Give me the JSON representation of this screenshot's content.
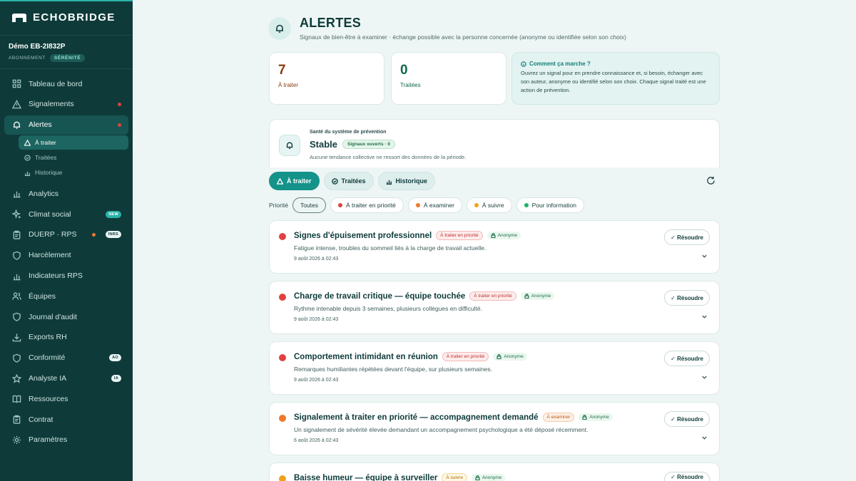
{
  "brand": {
    "name": "ECHOBRIDGE"
  },
  "account": {
    "name": "Démo EB-2I832P",
    "plan_label": "ABONNEMENT",
    "plan": "SÉRÉNITÉ"
  },
  "nav": {
    "dashboard": "Tableau de bord",
    "reports": "Signalements",
    "alerts": "Alertes",
    "alerts_sub": {
      "todo": "À traiter",
      "done": "Traitées",
      "history": "Historique"
    },
    "analytics": "Analytics",
    "climate": "Climat social",
    "climate_tag": "NEW",
    "duerp": "DUERP · RPS",
    "duerp_tag": "INRS",
    "harassment": "Harcèlement",
    "indicators": "Indicateurs RPS",
    "teams": "Équipes",
    "audit": "Journal d'audit",
    "exports": "Exports RH",
    "compliance": "Conformité",
    "compliance_tag": "AO",
    "ai": "Analyste IA",
    "ai_tag": "IA",
    "resources": "Ressources",
    "contract": "Contrat",
    "settings": "Paramètres"
  },
  "header": {
    "title": "ALERTES",
    "subtitle": "Signaux de bien-être à examiner · échange possible avec la personne concernée (anonyme ou identifiée selon son choix)"
  },
  "stats": {
    "todo": {
      "value": "7",
      "label": "À traiter",
      "color": "#8a3b12"
    },
    "done": {
      "value": "0",
      "label": "Traitées",
      "color": "#0e6b4a"
    }
  },
  "how": {
    "title": "Comment ça marche ?",
    "text": "Ouvrez un signal pour en prendre connaissance et, si besoin, échanger avec son auteur, anonyme ou identifié selon son choix. Chaque signal traité est une action de prévention."
  },
  "health": {
    "label": "Santé du système de prévention",
    "status": "Stable",
    "badge": "Signaux ouverts · 0",
    "desc": "Aucune tendance collective ne ressort des données de la période."
  },
  "tabs": {
    "todo": "À traiter",
    "done": "Traitées",
    "history": "Historique"
  },
  "filters": {
    "label": "Priorité",
    "all": "Toutes",
    "priority": "À traiter en priorité",
    "examine": "À examiner",
    "follow": "À suivre",
    "info": "Pour information"
  },
  "colors": {
    "red": "#e0413f",
    "orange": "#ee7a2b",
    "amber": "#f0a21f",
    "green": "#20b36b"
  },
  "alerts": [
    {
      "title": "Signes d'épuisement professionnel",
      "badge": "À traiter en priorité",
      "anon": "Anonyme",
      "desc": "Fatigue intense, troubles du sommeil liés à la charge de travail actuelle.",
      "date": "9 août 2026 à 02:43",
      "resolve": "✓ Résoudre"
    },
    {
      "title": "Charge de travail critique — équipe touchée",
      "badge": "À traiter en priorité",
      "anon": "Anonyme",
      "desc": "Rythme intenable depuis 3 semaines, plusieurs collègues en difficulté.",
      "date": "9 août 2026 à 02:43",
      "resolve": "✓ Résoudre"
    },
    {
      "title": "Comportement intimidant en réunion",
      "badge": "À traiter en priorité",
      "anon": "Anonyme",
      "desc": "Remarques humiliantes répétées devant l'équipe, sur plusieurs semaines.",
      "date": "9 août 2026 à 02:43",
      "resolve": "✓ Résoudre"
    },
    {
      "title": "Signalement à traiter en priorité — accompagnement demandé",
      "badge": "À examiner",
      "anon": "Anonyme",
      "desc": "Un signalement de sévérité élevée demandant un accompagnement psychologique a été déposé récemment.",
      "date": "6 août 2026 à 02:43",
      "resolve": "✓ Résoudre"
    },
    {
      "title": "Baisse humeur — équipe à surveiller",
      "badge": "À suivre",
      "anon": "Anonyme",
      "resolve": "✓ Résoudre"
    }
  ]
}
